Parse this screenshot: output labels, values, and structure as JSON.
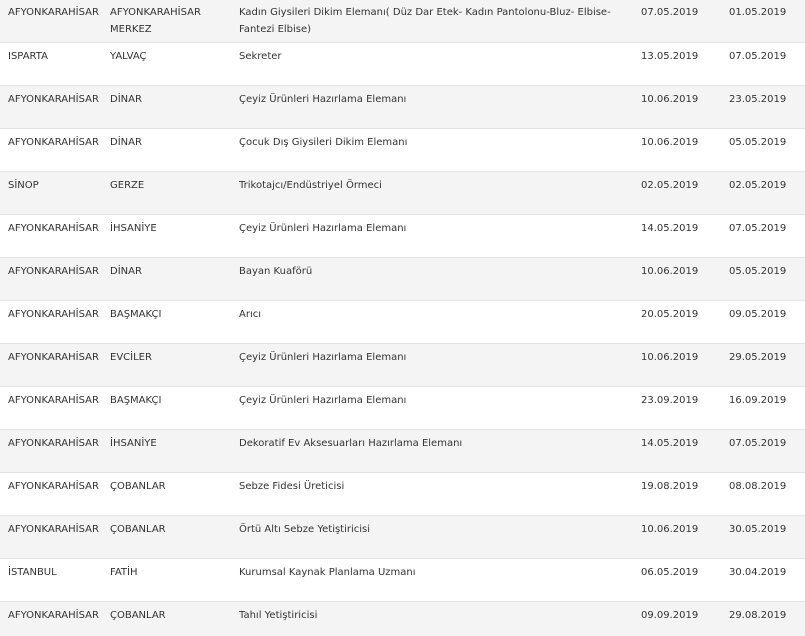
{
  "rows": [
    {
      "city": "AFYONKARAHİSAR",
      "district": "AFYONKARAHİSAR MERKEZ",
      "course": "Kadın Giysileri Dikim Elemanı( Düz Dar Etek- Kadın Pantolonu-Bluz- Elbise-Fantezi Elbise)",
      "start": "07.05.2019",
      "end": "01.05.2019"
    },
    {
      "city": "ISPARTA",
      "district": "YALVAÇ",
      "course": "Sekreter",
      "start": "13.05.2019",
      "end": "07.05.2019"
    },
    {
      "city": "AFYONKARAHİSAR",
      "district": "DİNAR",
      "course": "Çeyiz Ürünleri Hazırlama Elemanı",
      "start": "10.06.2019",
      "end": "23.05.2019"
    },
    {
      "city": "AFYONKARAHİSAR",
      "district": "DİNAR",
      "course": "Çocuk Dış Giysileri Dikim Elemanı",
      "start": "10.06.2019",
      "end": "05.05.2019"
    },
    {
      "city": "SİNOP",
      "district": "GERZE",
      "course": "Trikotajcı/Endüstriyel Örmeci",
      "start": "02.05.2019",
      "end": "02.05.2019"
    },
    {
      "city": "AFYONKARAHİSAR",
      "district": "İHSANİYE",
      "course": "Çeyiz Ürünleri Hazırlama Elemanı",
      "start": "14.05.2019",
      "end": "07.05.2019"
    },
    {
      "city": "AFYONKARAHİSAR",
      "district": "DİNAR",
      "course": "Bayan Kuaförü",
      "start": "10.06.2019",
      "end": "05.05.2019"
    },
    {
      "city": "AFYONKARAHİSAR",
      "district": "BAŞMAKÇI",
      "course": "Arıcı",
      "start": "20.05.2019",
      "end": "09.05.2019"
    },
    {
      "city": "AFYONKARAHİSAR",
      "district": "EVCİLER",
      "course": "Çeyiz Ürünleri Hazırlama Elemanı",
      "start": "10.06.2019",
      "end": "29.05.2019"
    },
    {
      "city": "AFYONKARAHİSAR",
      "district": "BAŞMAKÇI",
      "course": "Çeyiz Ürünleri Hazırlama Elemanı",
      "start": "23.09.2019",
      "end": "16.09.2019"
    },
    {
      "city": "AFYONKARAHİSAR",
      "district": "İHSANİYE",
      "course": "Dekoratif Ev Aksesuarları Hazırlama Elemanı",
      "start": "14.05.2019",
      "end": "07.05.2019"
    },
    {
      "city": "AFYONKARAHİSAR",
      "district": "ÇOBANLAR",
      "course": "Sebze Fidesi Üreticisi",
      "start": "19.08.2019",
      "end": "08.08.2019"
    },
    {
      "city": "AFYONKARAHİSAR",
      "district": "ÇOBANLAR",
      "course": "Örtü Altı Sebze Yetiştiricisi",
      "start": "10.06.2019",
      "end": "30.05.2019"
    },
    {
      "city": "İSTANBUL",
      "district": "FATİH",
      "course": "Kurumsal Kaynak Planlama Uzmanı",
      "start": "06.05.2019",
      "end": "30.04.2019"
    },
    {
      "city": "AFYONKARAHİSAR",
      "district": "ÇOBANLAR",
      "course": "Tahıl Yetiştiricisi",
      "start": "09.09.2019",
      "end": "29.08.2019"
    }
  ],
  "colors": {
    "odd_row_bg": "#f4f4f4",
    "even_row_bg": "#ffffff",
    "border": "#e2e2e2",
    "text": "#333333",
    "link": "#1f4e8c"
  }
}
